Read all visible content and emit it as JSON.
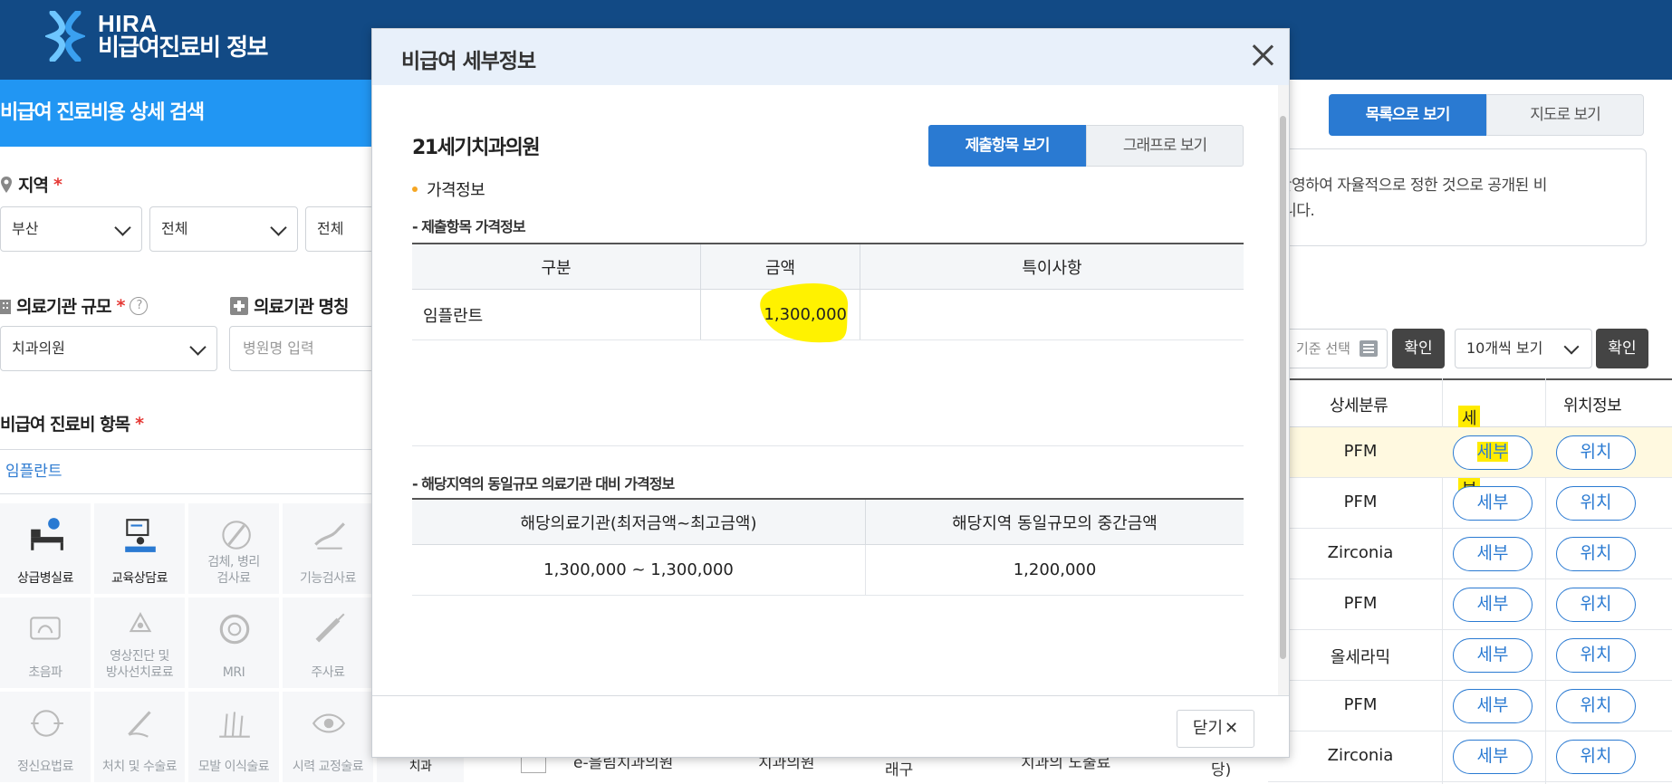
{
  "header": {
    "logo_line1": "HIRA",
    "logo_line2": "비급여진료비 정보"
  },
  "sidebar": {
    "title": "비급여 진료비용 상세 검색",
    "region_label": "지역",
    "required_mark": "*",
    "region_selects": [
      "부산",
      "전체",
      "전체"
    ],
    "scale_label": "의료기관 규모",
    "scale_help": "?",
    "scale_value": "치과의원",
    "name_label": "의료기관 명칭",
    "name_placeholder": "병원명 입력",
    "item_label": "비급여 진료비 항목",
    "item_value": "임플란트",
    "categories": [
      {
        "label": "상급병실료",
        "icon": "hospital-bed-icon",
        "state": "active"
      },
      {
        "label": "교육상담료",
        "icon": "counseling-icon",
        "state": "active"
      },
      {
        "label": "검체, 병리\n검사료",
        "icon": "pathology-icon",
        "state": "dim"
      },
      {
        "label": "기능검사료",
        "icon": "function-test-icon",
        "state": "dim"
      },
      {
        "label": "초음파",
        "icon": "ultrasound-icon",
        "state": "dim"
      },
      {
        "label": "영상진단 및\n방사선치료료",
        "icon": "radiology-icon",
        "state": "dim"
      },
      {
        "label": "MRI",
        "icon": "mri-icon",
        "state": "dim"
      },
      {
        "label": "주사료",
        "icon": "syringe-icon",
        "state": "dim"
      },
      {
        "label": "정신요법료",
        "icon": "brain-icon",
        "state": "dim"
      },
      {
        "label": "처치 및 수술료",
        "icon": "surgery-icon",
        "state": "dim"
      },
      {
        "label": "모발 이식술료",
        "icon": "hair-icon",
        "state": "dim"
      },
      {
        "label": "시력 교정술료",
        "icon": "eye-icon",
        "state": "dim"
      },
      {
        "label": "치과",
        "icon": "tooth-icon",
        "state": "active"
      }
    ]
  },
  "main": {
    "view_list": "목록으로 보기",
    "view_map": "지도로 보기",
    "notice_line1": "· 반영하여 자율적으로 정한 것으로 공개된 비",
    "notice_line2": "랍니다.",
    "sort_placeholder": "기준 선택",
    "confirm": "확인",
    "per_page": "10개씩 보기",
    "columns": {
      "category": "상세분류",
      "detail": "세부정보",
      "location": "위치정보"
    },
    "detail_btn": "세부",
    "location_btn": "위치",
    "rows": [
      "PFM",
      "PFM",
      "Zirconia",
      "PFM",
      "올세라믹",
      "PFM",
      "Zirconia"
    ],
    "under_row": [
      "e-을림치과의원",
      "치과의원",
      "래구",
      "치과의 노출료",
      "당)"
    ]
  },
  "modal": {
    "title": "비급여 세부정보",
    "hospital": "21세기치과의원",
    "tab_items": "제출항목 보기",
    "tab_graph": "그래프로 보기",
    "section": "가격정보",
    "sub1": "- 제출항목 가격정보",
    "table1": {
      "headers": [
        "구분",
        "금액",
        "특이사항"
      ],
      "rows": [
        {
          "item": "임플란트",
          "amount": "1,300,000",
          "note": ""
        }
      ]
    },
    "sub2": "- 해당지역의 동일규모 의료기관 대비 가격정보",
    "table2": {
      "headers": [
        "해당의료기관(최저금액~최고금액)",
        "해당지역 동일규모의 중간금액"
      ],
      "rows": [
        {
          "range": "1,300,000 ~ 1,300,000",
          "median": "1,200,000"
        }
      ]
    },
    "close_label": "닫기"
  },
  "colors": {
    "header_bg": "#124a85",
    "primary": "#2a7ad2",
    "sidebar_title": "#2196f3",
    "highlight": "#ffeb00",
    "required": "#e53935"
  }
}
